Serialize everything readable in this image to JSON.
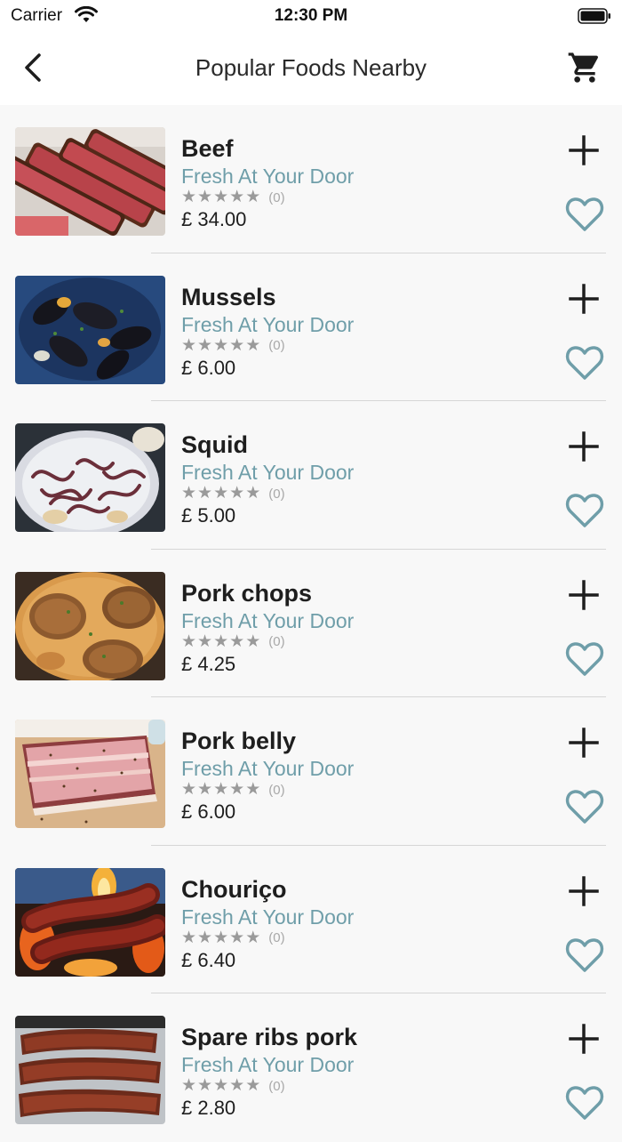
{
  "status_bar": {
    "carrier": "Carrier",
    "time": "12:30 PM"
  },
  "nav": {
    "title": "Popular Foods Nearby"
  },
  "foods": [
    {
      "name": "Beef",
      "tagline": "Fresh At Your Door",
      "rating_count": "(0)",
      "price": "£ 34.00",
      "image": "beef"
    },
    {
      "name": "Mussels",
      "tagline": "Fresh At Your Door",
      "rating_count": "(0)",
      "price": "£ 6.00",
      "image": "mussels"
    },
    {
      "name": "Squid",
      "tagline": "Fresh At Your Door",
      "rating_count": "(0)",
      "price": "£ 5.00",
      "image": "squid"
    },
    {
      "name": "Pork chops",
      "tagline": "Fresh At Your Door",
      "rating_count": "(0)",
      "price": "£ 4.25",
      "image": "porkchops"
    },
    {
      "name": "Pork belly",
      "tagline": "Fresh At Your Door",
      "rating_count": "(0)",
      "price": "£ 6.00",
      "image": "porkbelly"
    },
    {
      "name": "Chouriço",
      "tagline": "Fresh At Your Door",
      "rating_count": "(0)",
      "price": "£ 6.40",
      "image": "chourico"
    },
    {
      "name": "Spare ribs pork",
      "tagline": "Fresh At Your Door",
      "rating_count": "(0)",
      "price": "£ 2.80",
      "image": "spareribs"
    }
  ],
  "colors": {
    "accent": "#6f9ea9",
    "text": "#1e1e1e",
    "star": "#9a9a9a",
    "background": "#f8f8f8"
  },
  "icons": {
    "back": "chevron-left-icon",
    "cart": "cart-icon",
    "add": "plus-icon",
    "favorite": "heart-outline-icon",
    "star": "star-icon"
  }
}
